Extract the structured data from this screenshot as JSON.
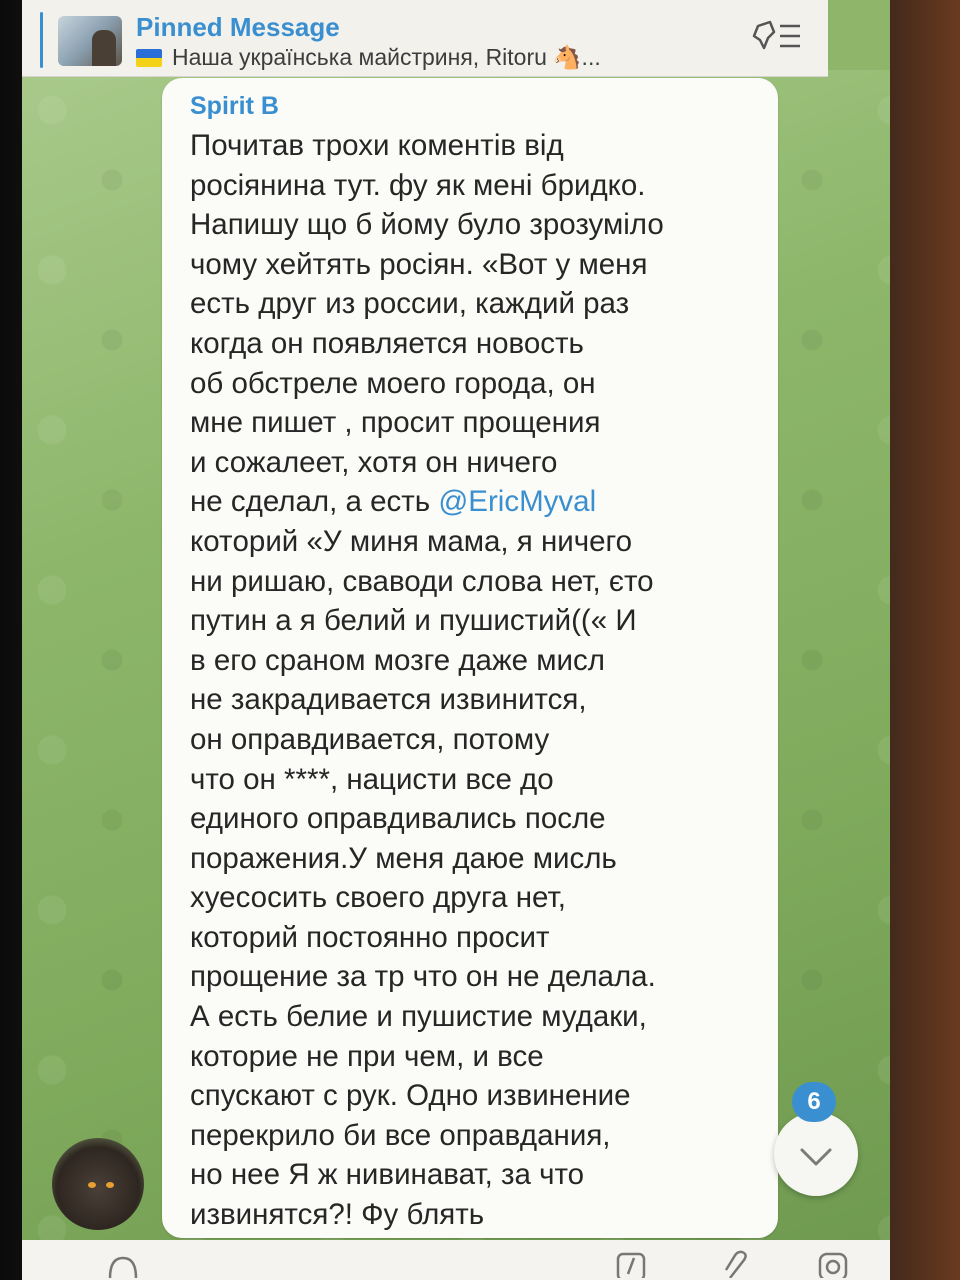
{
  "pinned": {
    "title": "Pinned Message",
    "subtitle": "Наша українська майстриня, Ritoru",
    "subtitle_suffix": "🐴..."
  },
  "message": {
    "sender": "Spirit B",
    "lines": [
      "Почитав трохи коментів від",
      "росіянина тут. фу як мені бридко.",
      "Напишу що б йому було зрозуміло",
      "чому хейтять росіян. «Вот у меня",
      "есть друг из россии, каждий раз",
      "когда он появляется новость",
      "об обстреле моего города, он",
      "мне пишет , просит прощения",
      "и сожалеет, хотя он ничего",
      "не сделал, а есть",
      "котoрий «У миня мама, я ничего",
      "ни ришаю, сваводи слова нет, єто",
      "путин а я белий и пушистий((« И",
      "в его сраном  мозге даже мисл",
      "не закрадивается извинится,",
      "он оправдивается, потому",
      "что он ****, нацисти все до",
      "единого оправдивались после",
      "поражения.У меня даюе мисль",
      "хуесосить своего друга нет,",
      "которий постоянно просит",
      "прощение за тр что он не делала.",
      "А есть белие и пушистие мудаки,",
      "которие не при чем, и все",
      "спускают с рук. Одно извинение",
      "перекрило би все оправдания,",
      "но нее Я ж нивинават, за что",
      "извинятся?! Фу блять"
    ],
    "mention": "@EricMyval"
  },
  "scroll_down": {
    "unread_count": "6"
  },
  "icons": {
    "pin_list": "pin-list-icon",
    "chevron": "chevron-down-icon",
    "slash": "command-icon",
    "attach": "paperclip-icon",
    "camera": "camera-icon"
  },
  "colors": {
    "accent": "#3a8fd0",
    "bubble": "#fbfbf7",
    "wallpaper": "#8db66a"
  }
}
